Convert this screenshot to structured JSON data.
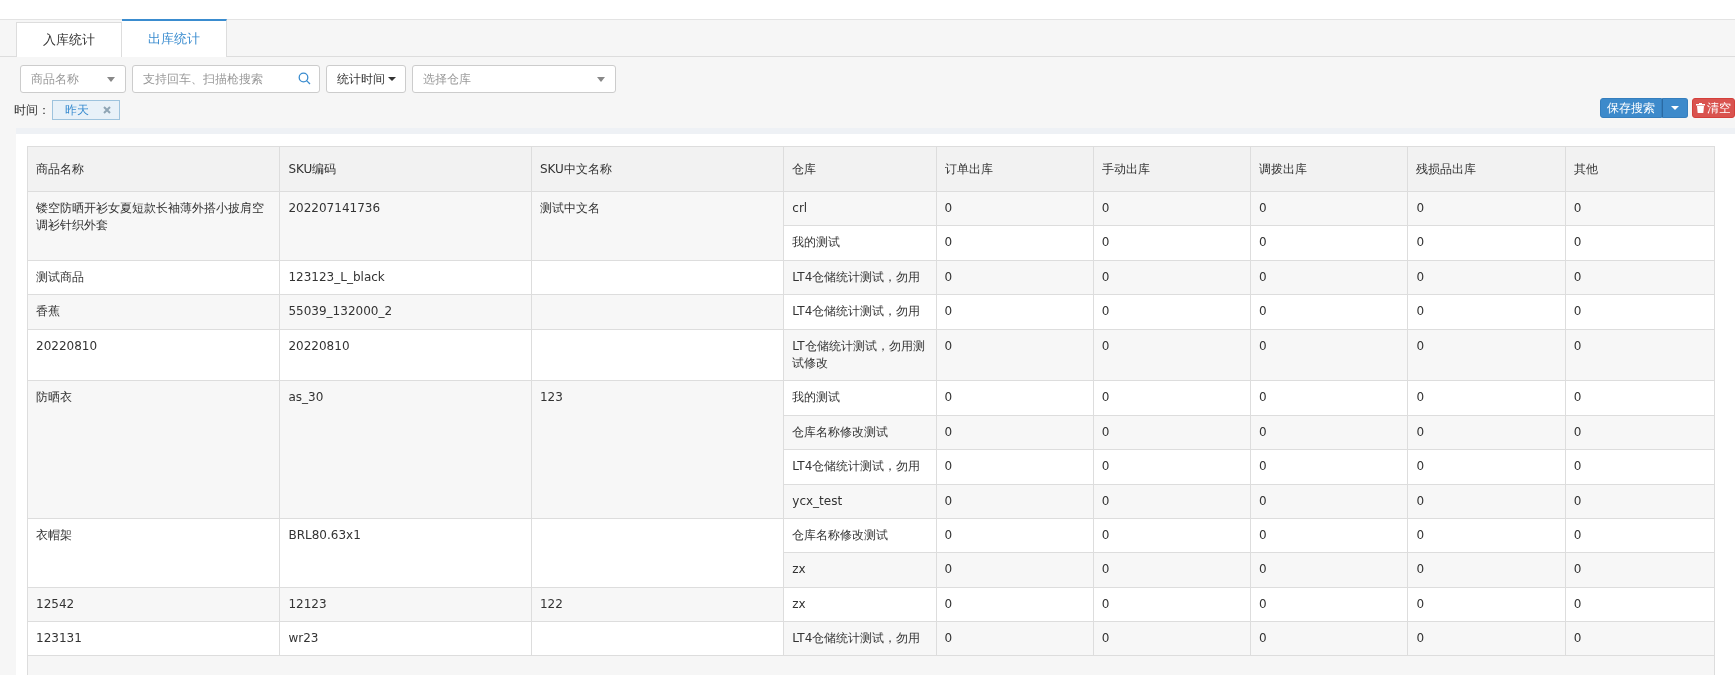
{
  "tabs": [
    {
      "label": "入库统计",
      "selected": false
    },
    {
      "label": "出库统计",
      "selected": true
    }
  ],
  "filters": {
    "product_select": {
      "placeholder": "商品名称"
    },
    "search": {
      "placeholder": "支持回车、扫描枪搜索"
    },
    "time_button": "统计时间",
    "warehouse_select": {
      "placeholder": "选择仓库"
    }
  },
  "time_filter": {
    "label": "时间：",
    "tag": "昨天"
  },
  "actions": {
    "save_search": "保存搜索",
    "clear": "清空"
  },
  "table": {
    "columns": [
      "商品名称",
      "SKU编码",
      "SKU中文名称",
      "仓库",
      "订单出库",
      "手动出库",
      "调拨出库",
      "残损品出库",
      "其他"
    ],
    "rows": [
      {
        "product": "镂空防晒开衫女夏短款长袖薄外搭小披肩空调衫针织外套",
        "sku": "202207141736",
        "sku_cn": "测试中文名",
        "warehouses": [
          {
            "name": "crl",
            "values": [
              "0",
              "0",
              "0",
              "0",
              "0"
            ]
          },
          {
            "name": "我的测试",
            "values": [
              "0",
              "0",
              "0",
              "0",
              "0"
            ]
          }
        ]
      },
      {
        "product": "测试商品",
        "sku": "123123_L_black",
        "warehouses": [
          {
            "name": "LT4仓储统计测试，勿用",
            "values": [
              "0",
              "0",
              "0",
              "0",
              "0"
            ]
          }
        ]
      },
      {
        "product": "香蕉",
        "sku": "55039_132000_2",
        "warehouses": [
          {
            "name": "LT4仓储统计测试，勿用",
            "values": [
              "0",
              "0",
              "0",
              "0",
              "0"
            ]
          }
        ]
      },
      {
        "product": "20220810",
        "sku": "20220810",
        "warehouses": [
          {
            "name": "LT仓储统计测试，勿用测试修改",
            "values": [
              "0",
              "0",
              "0",
              "0",
              "0"
            ]
          }
        ]
      },
      {
        "product": "防晒衣",
        "sku": "as_30",
        "sku_cn": "123",
        "warehouses": [
          {
            "name": "我的测试",
            "values": [
              "0",
              "0",
              "0",
              "0",
              "0"
            ]
          },
          {
            "name": "仓库名称修改测试",
            "values": [
              "0",
              "0",
              "0",
              "0",
              "0"
            ]
          },
          {
            "name": "LT4仓储统计测试，勿用",
            "values": [
              "0",
              "0",
              "0",
              "0",
              "0"
            ]
          },
          {
            "name": "ycx_test",
            "values": [
              "0",
              "0",
              "0",
              "0",
              "0"
            ]
          }
        ]
      },
      {
        "product": "衣帽架",
        "sku": "BRL80.63x1",
        "warehouses": [
          {
            "name": "仓库名称修改测试",
            "values": [
              "0",
              "0",
              "0",
              "0",
              "0"
            ]
          },
          {
            "name": "zx",
            "values": [
              "0",
              "0",
              "0",
              "0",
              "0"
            ]
          }
        ]
      },
      {
        "product": "12542",
        "sku": "12123",
        "sku_cn": "122",
        "warehouses": [
          {
            "name": "zx",
            "values": [
              "0",
              "0",
              "0",
              "0",
              "0"
            ]
          }
        ]
      },
      {
        "product": "123131",
        "sku": "wr23",
        "warehouses": [
          {
            "name": "LT4仓储统计测试，勿用",
            "values": [
              "0",
              "0",
              "0",
              "0",
              "0"
            ]
          }
        ]
      }
    ]
  }
}
